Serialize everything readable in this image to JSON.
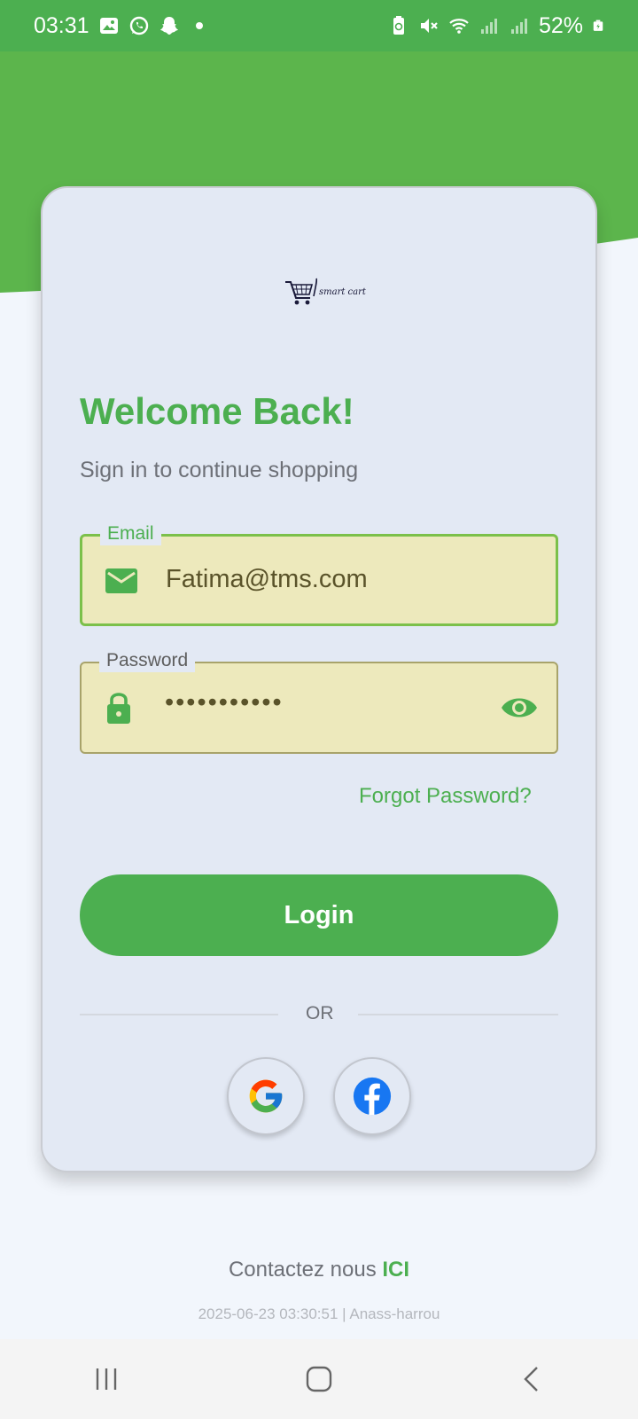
{
  "status_bar": {
    "time": "03:31",
    "battery": "52%"
  },
  "login": {
    "title": "Welcome Back!",
    "subtitle": "Sign in to continue shopping",
    "email_label": "Email",
    "email_value": "Fatima@tms.com",
    "password_label": "Password",
    "password_value": "•••••••••••",
    "forgot_password": "Forgot Password?",
    "login_button": "Login",
    "or_text": "OR"
  },
  "logo": {
    "text": "smart cart"
  },
  "footer": {
    "contact_prefix": "Contactez nous",
    "contact_link": "ICI",
    "timestamp": "2025-06-23 03:30:51 | Anass-harrou"
  },
  "colors": {
    "brand_green": "#4caf50",
    "field_bg": "#ede9bc",
    "card_bg": "#e3e9f4"
  },
  "icons": [
    "gallery-icon",
    "whatsapp-icon",
    "snapchat-icon",
    "notification-dot-icon",
    "battery-saver-icon",
    "mute-icon",
    "wifi-icon",
    "signal-icon",
    "battery-icon",
    "mail-icon",
    "lock-icon",
    "eye-icon",
    "google-icon",
    "facebook-icon",
    "recent-apps-icon",
    "home-icon",
    "back-icon"
  ]
}
